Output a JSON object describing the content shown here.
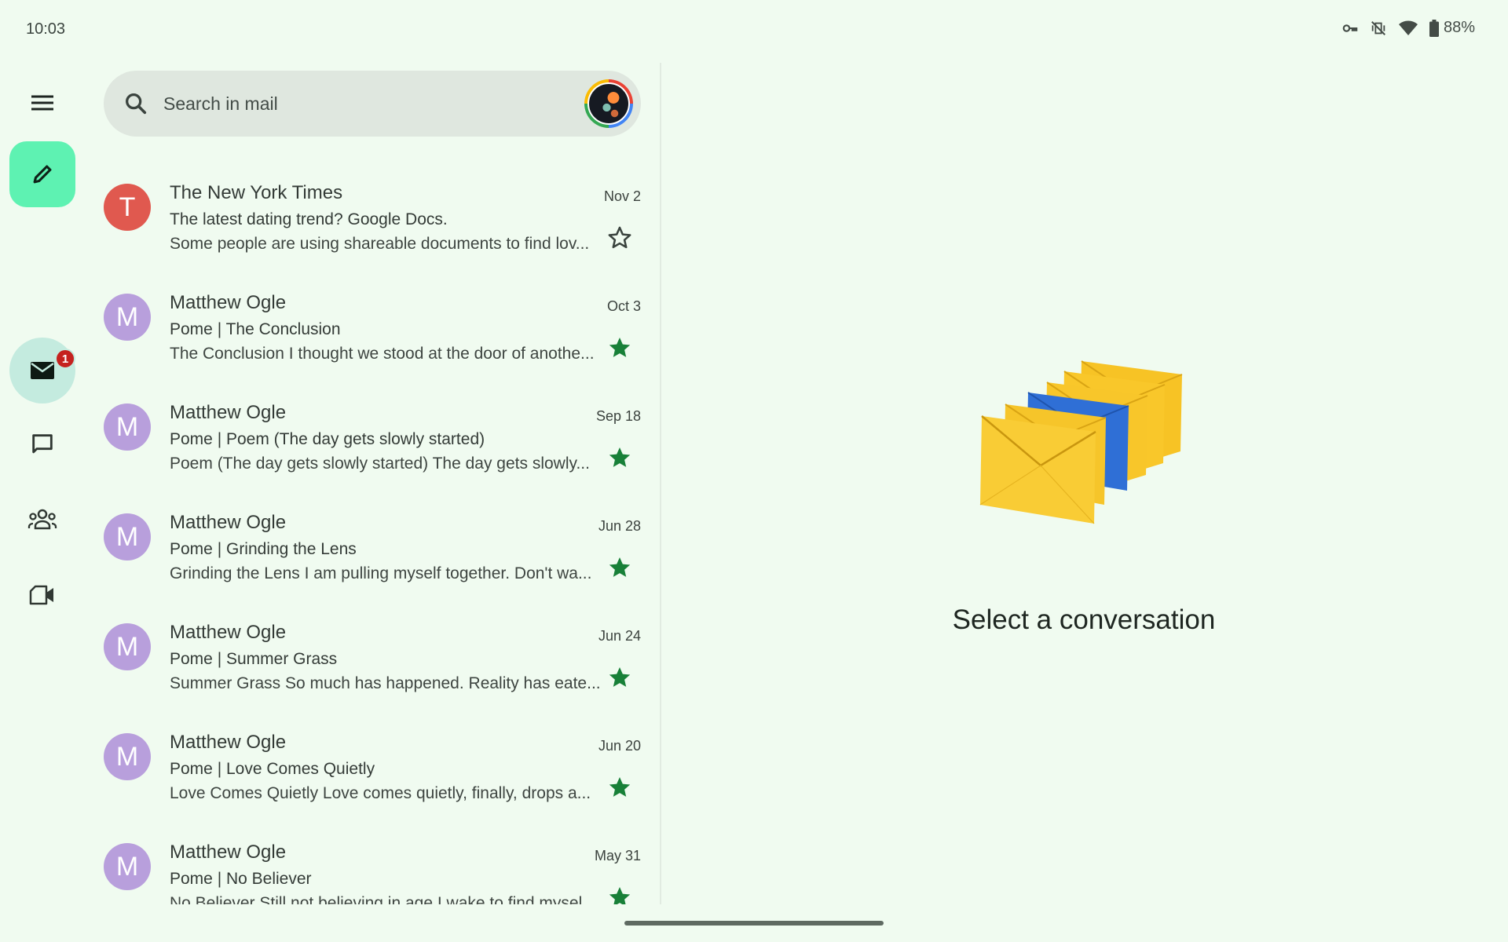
{
  "status_bar": {
    "time": "10:03",
    "icons": [
      "vpn-key-icon",
      "vibrate-off-icon",
      "wifi-icon",
      "battery-icon"
    ],
    "battery": "88%"
  },
  "nav_rail": {
    "menu_icon": "menu-icon",
    "compose_icon": "pencil-icon",
    "items": [
      {
        "name": "mail",
        "icon": "mail-icon",
        "active": true,
        "badge": "1"
      },
      {
        "name": "chat",
        "icon": "chat-icon",
        "active": false
      },
      {
        "name": "spaces",
        "icon": "group-icon",
        "active": false
      },
      {
        "name": "meet",
        "icon": "video-icon",
        "active": false
      }
    ]
  },
  "search": {
    "placeholder": "Search in mail",
    "value": ""
  },
  "colors": {
    "background": "#f0fbf0",
    "compose_fab": "#5ef2b2",
    "active_rail": "#c4ebdf",
    "star_filled": "#188038",
    "badge": "#c5221f",
    "avatar_red": "#e0594f",
    "avatar_purple": "#b89fdc"
  },
  "mail": [
    {
      "initial": "T",
      "avatar_color": "#e0594f",
      "sender": "The New York Times",
      "date": "Nov 2",
      "subject": "The latest dating trend? Google Docs.",
      "snippet": "Some people are using shareable documents to find lov...",
      "starred": false
    },
    {
      "initial": "M",
      "avatar_color": "#b89fdc",
      "sender": "Matthew Ogle",
      "date": "Oct 3",
      "subject": "Pome | The Conclusion",
      "snippet": "The Conclusion I thought we stood at the door of anothe...",
      "starred": true
    },
    {
      "initial": "M",
      "avatar_color": "#b89fdc",
      "sender": "Matthew Ogle",
      "date": "Sep 18",
      "subject": "Pome | Poem (The day gets slowly started)",
      "snippet": "Poem (The day gets slowly started) The day gets slowly...",
      "starred": true
    },
    {
      "initial": "M",
      "avatar_color": "#b89fdc",
      "sender": "Matthew Ogle",
      "date": "Jun 28",
      "subject": "Pome | Grinding the Lens",
      "snippet": "Grinding the Lens I am pulling myself together. Don't wa...",
      "starred": true
    },
    {
      "initial": "M",
      "avatar_color": "#b89fdc",
      "sender": "Matthew Ogle",
      "date": "Jun 24",
      "subject": "Pome | Summer Grass",
      "snippet": "Summer Grass So much has happened. Reality has eate...",
      "starred": true
    },
    {
      "initial": "M",
      "avatar_color": "#b89fdc",
      "sender": "Matthew Ogle",
      "date": "Jun 20",
      "subject": "Pome | Love Comes Quietly",
      "snippet": "Love Comes Quietly Love comes quietly, finally, drops a...",
      "starred": true
    },
    {
      "initial": "M",
      "avatar_color": "#b89fdc",
      "sender": "Matthew Ogle",
      "date": "May 31",
      "subject": "Pome | No Believer",
      "snippet": "No Believer Still not believing in age I wake to find mysel",
      "starred": true
    }
  ],
  "detail_pane": {
    "illustration": "envelopes-illustration",
    "empty_text": "Select a conversation"
  }
}
